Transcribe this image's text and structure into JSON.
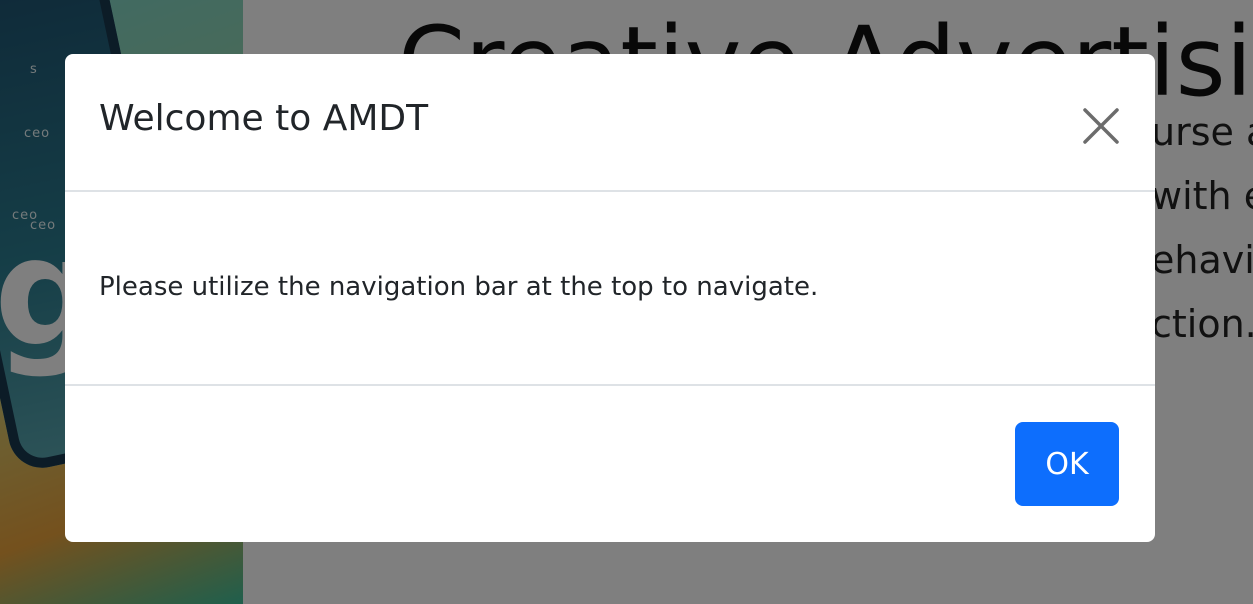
{
  "background": {
    "hero_title": "Creative Advertisin",
    "hero_paragraph_lines": [
      "urse a",
      "with e",
      "ehavi",
      "ction."
    ],
    "hero_image_letter": "g",
    "hero_image_dots": [
      "ceo",
      "ceo",
      "ceo",
      "s"
    ]
  },
  "modal": {
    "title": "Welcome to AMDT",
    "close_icon": "close-icon",
    "message": "Please utilize the navigation bar at the top to navigate.",
    "ok_label": "OK"
  },
  "colors": {
    "primary_button": "#0d6efd",
    "backdrop": "rgba(0,0,0,0.5)",
    "divider": "#dee2e6"
  }
}
